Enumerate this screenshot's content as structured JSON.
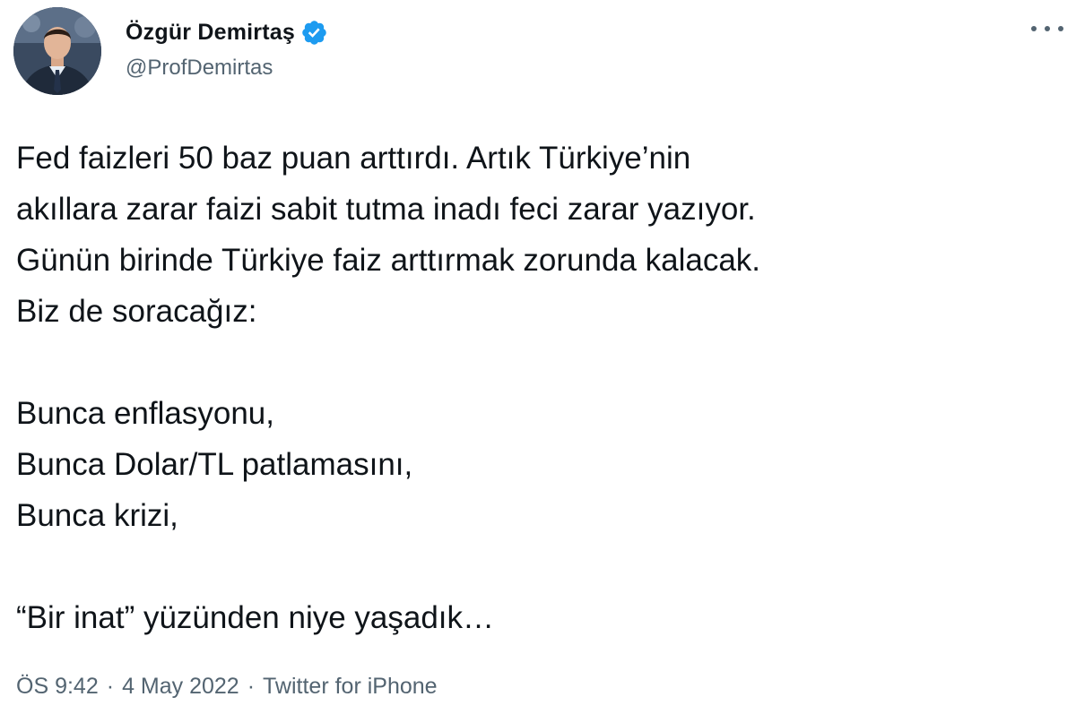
{
  "author": {
    "display_name": "Özgür Demirtaş",
    "handle": "@ProfDemirtas",
    "verified": true
  },
  "tweet": {
    "lines": [
      "Fed faizleri 50 baz puan arttırdı. Artık Türkiye’nin",
      "akıllara zarar faizi sabit tutma inadı feci zarar yazıyor.",
      "Günün birinde Türkiye faiz arttırmak zorunda kalacak.",
      "Biz de soracağız:",
      "",
      "Bunca enflasyonu,",
      "Bunca Dolar/TL patlamasını,",
      "Bunca krizi,",
      "",
      "“Bir inat” yüzünden niye yaşadık…"
    ]
  },
  "meta": {
    "time": "ÖS 9:42",
    "separator": "·",
    "date": "4 May 2022",
    "source": "Twitter for iPhone"
  },
  "icons": {
    "verified": "verified-badge-icon",
    "more": "more-options-icon"
  },
  "colors": {
    "text_primary": "#0f1419",
    "text_secondary": "#536471",
    "verified_blue": "#1d9bf0"
  }
}
